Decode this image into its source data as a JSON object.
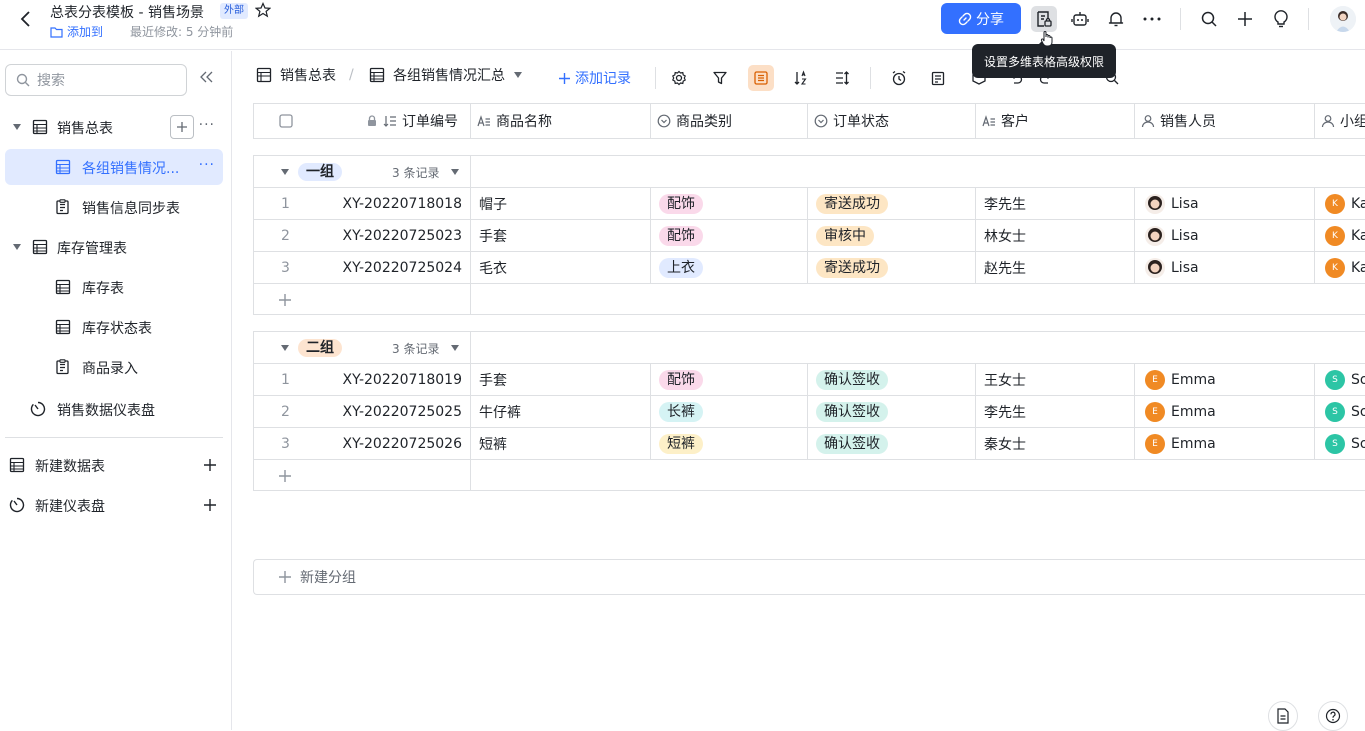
{
  "header": {
    "title": "总表分表模板 - 销售场景",
    "badge": "外部",
    "add_to": "添加到",
    "last_modified": "最近修改: 5 分钟前",
    "share_label": "分享",
    "tooltip": "设置多维表格高级权限"
  },
  "sidebar": {
    "search_placeholder": "搜索",
    "items": [
      {
        "label": "销售总表"
      },
      {
        "label": "各组销售情况..."
      },
      {
        "label": "销售信息同步表"
      },
      {
        "label": "库存管理表"
      },
      {
        "label": "库存表"
      },
      {
        "label": "库存状态表"
      },
      {
        "label": "商品录入"
      },
      {
        "label": "销售数据仪表盘"
      }
    ],
    "new_table": "新建数据表",
    "new_dashboard": "新建仪表盘"
  },
  "viewbar": {
    "table_name": "销售总表",
    "view_name": "各组销售情况汇总",
    "add_record": "添加记录"
  },
  "columns": [
    "订单编号",
    "商品名称",
    "商品类别",
    "订单状态",
    "客户",
    "销售人员",
    "小组"
  ],
  "groups": [
    {
      "name": "一组",
      "count": "3 条记录",
      "rows": [
        {
          "n": "1",
          "code": "XY-20220718018",
          "product": "帽子",
          "category": "配饰",
          "status": "寄送成功",
          "customer": "李先生",
          "sales": "Lisa",
          "team_initial": "K",
          "team": "Ka"
        },
        {
          "n": "2",
          "code": "XY-20220725023",
          "product": "手套",
          "category": "配饰",
          "status": "审核中",
          "customer": "林女士",
          "sales": "Lisa",
          "team_initial": "K",
          "team": "Ka"
        },
        {
          "n": "3",
          "code": "XY-20220725024",
          "product": "毛衣",
          "category": "上衣",
          "status": "寄送成功",
          "customer": "赵先生",
          "sales": "Lisa",
          "team_initial": "K",
          "team": "Ka"
        }
      ]
    },
    {
      "name": "二组",
      "count": "3 条记录",
      "rows": [
        {
          "n": "1",
          "code": "XY-20220718019",
          "product": "手套",
          "category": "配饰",
          "status": "确认签收",
          "customer": "王女士",
          "sales": "Emma",
          "sales_initial": "E",
          "team_initial": "S",
          "team": "So"
        },
        {
          "n": "2",
          "code": "XY-20220725025",
          "product": "牛仔裤",
          "category": "长裤",
          "status": "确认签收",
          "customer": "李先生",
          "sales": "Emma",
          "sales_initial": "E",
          "team_initial": "S",
          "team": "So"
        },
        {
          "n": "3",
          "code": "XY-20220725026",
          "product": "短裤",
          "category": "短裤",
          "status": "确认签收",
          "customer": "秦女士",
          "sales": "Emma",
          "sales_initial": "E",
          "team_initial": "S",
          "team": "So"
        }
      ]
    }
  ],
  "new_group": "新建分组",
  "colors": {
    "accent": "#3370ff",
    "tag_accessory": "#fad9ea",
    "tag_top": "#e1eaff",
    "tag_pants": "#d5f3f4",
    "tag_shorts": "#fdf0c8",
    "status_sent": "#fde6c4",
    "status_review": "#fde6c4",
    "status_signed": "#d4f2ec",
    "group1_tag": "#e1eaff",
    "group2_tag": "#fde4d0"
  }
}
